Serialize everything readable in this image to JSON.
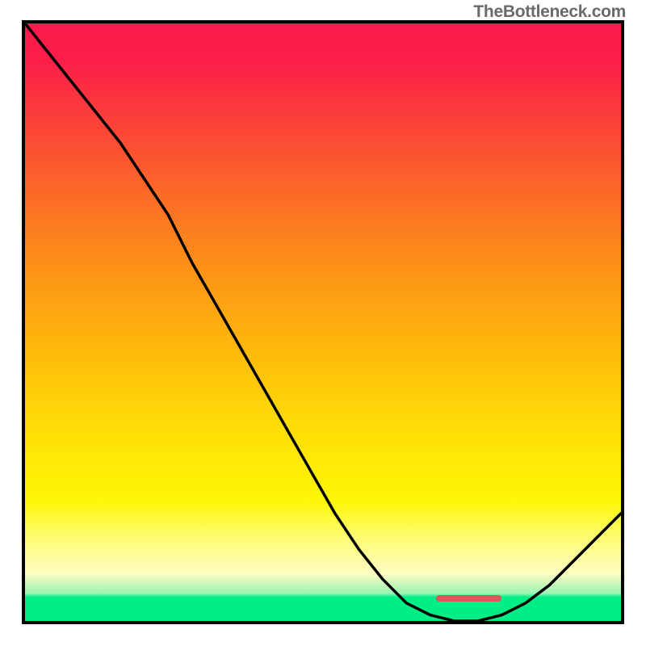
{
  "attribution": "TheBottleneck.com",
  "chart_data": {
    "type": "line",
    "title": "",
    "xlabel": "",
    "ylabel": "",
    "x": [
      0,
      4,
      8,
      12,
      16,
      20,
      24,
      28,
      32,
      36,
      40,
      44,
      48,
      52,
      56,
      60,
      64,
      68,
      72,
      76,
      80,
      84,
      88,
      92,
      96,
      100
    ],
    "y": [
      100,
      95,
      90,
      85,
      80,
      74,
      68,
      60,
      53,
      46,
      39,
      32,
      25,
      18,
      12,
      7,
      3,
      1,
      0,
      0,
      1,
      3,
      6,
      10,
      14,
      18
    ],
    "xlim": [
      0,
      100
    ],
    "ylim": [
      0,
      100
    ],
    "marker_range_x": [
      69,
      80
    ],
    "gradient_stops": [
      {
        "pos": 0.0,
        "color": "#fb1a4b"
      },
      {
        "pos": 0.3,
        "color": "#fc6f25"
      },
      {
        "pos": 0.68,
        "color": "#fede06"
      },
      {
        "pos": 0.92,
        "color": "#fefdc2"
      },
      {
        "pos": 0.96,
        "color": "#00ee86"
      },
      {
        "pos": 1.0,
        "color": "#00ee86"
      }
    ]
  }
}
